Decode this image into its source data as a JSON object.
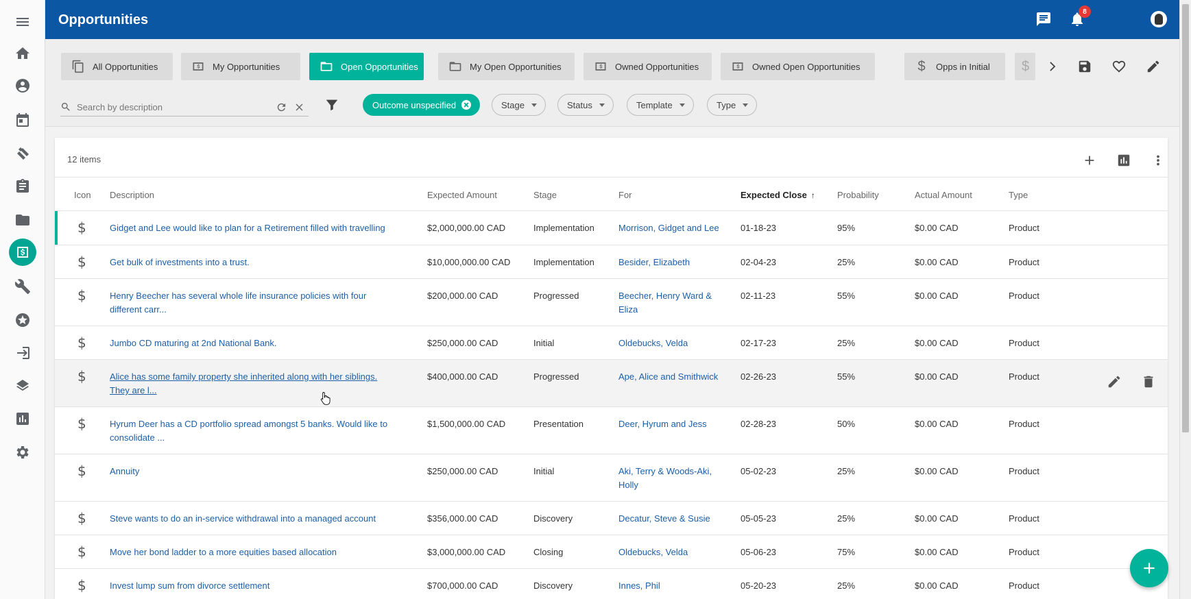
{
  "header": {
    "title": "Opportunities",
    "notification_count": "8"
  },
  "rail": {
    "items": [
      "menu-icon",
      "home-icon",
      "person-icon",
      "calendar-icon",
      "handshake-icon",
      "clipboard-icon",
      "folder-icon",
      "opportunity-icon",
      "wrench-icon",
      "star-icon",
      "login-icon",
      "layers-icon",
      "chart-icon",
      "gear-icon"
    ],
    "active": "opportunity-icon"
  },
  "views": {
    "tabs": [
      {
        "label": "All Opportunities",
        "icon": "copy-icon"
      },
      {
        "label": "My Opportunities",
        "icon": "money-icon"
      },
      {
        "label": "Open Opportunities",
        "icon": "folder-icon",
        "active": true
      },
      {
        "label": "My Open Opportunities",
        "icon": "folder-icon"
      },
      {
        "label": "Owned Opportunities",
        "icon": "money-icon"
      },
      {
        "label": "Owned Open Opportunities",
        "icon": "money-icon"
      },
      {
        "label": "Opps in Initial",
        "icon": "dollar-icon"
      }
    ]
  },
  "search": {
    "placeholder": "Search by description",
    "value": ""
  },
  "filters": {
    "active_chip": "Outcome unspecified",
    "chips": [
      "Stage",
      "Status",
      "Template",
      "Type"
    ]
  },
  "table": {
    "item_count": "12 items",
    "columns": [
      "Icon",
      "Description",
      "Expected Amount",
      "Stage",
      "For",
      "Expected Close",
      "Probability",
      "Actual Amount",
      "Type"
    ],
    "sorted_column": "Expected Close",
    "sort_arrow": "↑",
    "icon_glyph": "$",
    "rows": [
      {
        "description": "Gidget and Lee would like to plan for a Retirement filled with travelling",
        "expected_amount": "$2,000,000.00 CAD",
        "stage": "Implementation",
        "for": "Morrison, Gidget and Lee",
        "expected_close": "01-18-23",
        "probability": "95%",
        "actual_amount": "$0.00 CAD",
        "type": "Product"
      },
      {
        "description": "Get bulk of investments into a trust.",
        "expected_amount": "$10,000,000.00 CAD",
        "stage": "Implementation",
        "for": "Besider, Elizabeth",
        "expected_close": "02-04-23",
        "probability": "25%",
        "actual_amount": "$0.00 CAD",
        "type": "Product"
      },
      {
        "description": "Henry Beecher has several whole life insurance policies with four different carr...",
        "expected_amount": "$200,000.00 CAD",
        "stage": "Progressed",
        "for": "Beecher, Henry Ward & Eliza",
        "expected_close": "02-11-23",
        "probability": "55%",
        "actual_amount": "$0.00 CAD",
        "type": "Product"
      },
      {
        "description": "Jumbo CD maturing at 2nd National Bank.",
        "expected_amount": "$250,000.00 CAD",
        "stage": "Initial",
        "for": "Oldebucks, Velda",
        "expected_close": "02-17-23",
        "probability": "25%",
        "actual_amount": "$0.00 CAD",
        "type": "Product"
      },
      {
        "description": "Alice has some family property she inherited along with her siblings. They are l...",
        "expected_amount": "$400,000.00 CAD",
        "stage": "Progressed",
        "for": "Ape, Alice and Smithwick",
        "expected_close": "02-26-23",
        "probability": "55%",
        "actual_amount": "$0.00 CAD",
        "type": "Product"
      },
      {
        "description": "Hyrum Deer has a CD portfolio spread amongst 5 banks. Would like to consolidate ...",
        "expected_amount": "$1,500,000.00 CAD",
        "stage": "Presentation",
        "for": "Deer, Hyrum and Jess",
        "expected_close": "02-28-23",
        "probability": "50%",
        "actual_amount": "$0.00 CAD",
        "type": "Product"
      },
      {
        "description": "Annuity",
        "expected_amount": "$250,000.00 CAD",
        "stage": "Initial",
        "for": "Aki, Terry & Woods-Aki, Holly",
        "expected_close": "05-02-23",
        "probability": "25%",
        "actual_amount": "$0.00 CAD",
        "type": "Product"
      },
      {
        "description": "Steve wants to do an in-service withdrawal into a managed account",
        "expected_amount": "$356,000.00 CAD",
        "stage": "Discovery",
        "for": "Decatur, Steve & Susie",
        "expected_close": "05-05-23",
        "probability": "25%",
        "actual_amount": "$0.00 CAD",
        "type": "Product"
      },
      {
        "description": "Move her bond ladder to a more equities based allocation",
        "expected_amount": "$3,000,000.00 CAD",
        "stage": "Closing",
        "for": "Oldebucks, Velda",
        "expected_close": "05-06-23",
        "probability": "75%",
        "actual_amount": "$0.00 CAD",
        "type": "Product"
      },
      {
        "description": "Invest lump sum from divorce settlement",
        "expected_amount": "$700,000.00 CAD",
        "stage": "Discovery",
        "for": "Innes, Phil",
        "expected_close": "05-20-23",
        "probability": "25%",
        "actual_amount": "$0.00 CAD",
        "type": "Product"
      }
    ]
  },
  "colors": {
    "header": "#0b57a4",
    "accent": "#00b39a",
    "link": "#1c5fa8"
  }
}
